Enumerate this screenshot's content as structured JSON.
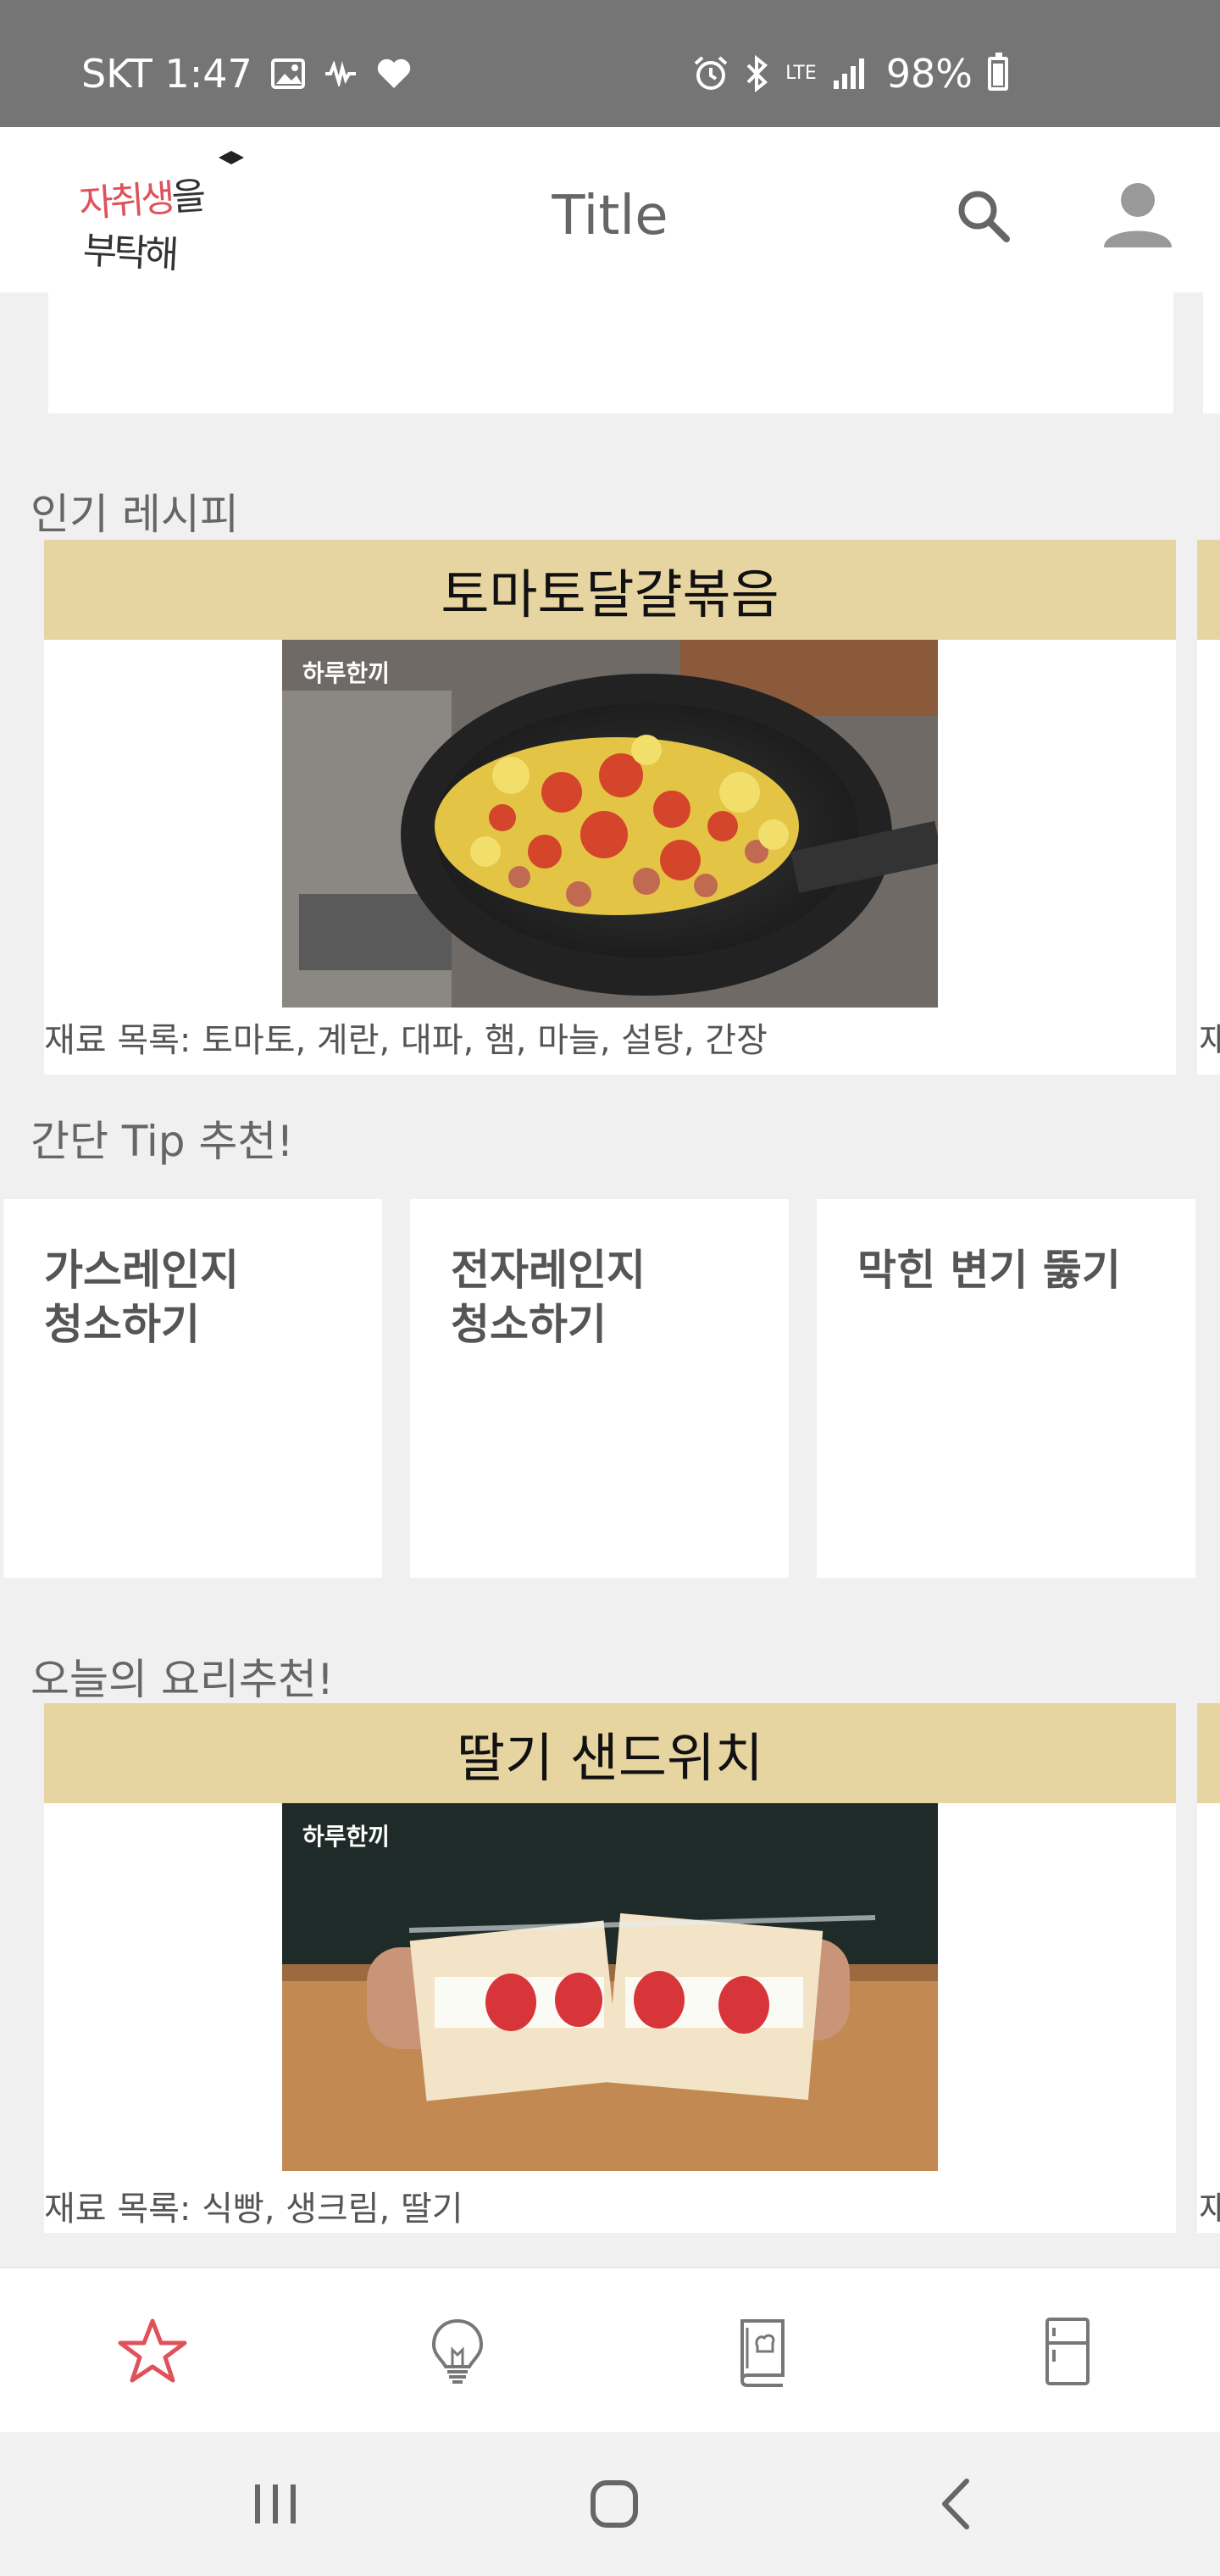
{
  "status_bar": {
    "carrier_time": "SKT 1:47",
    "network": "LTE",
    "battery": "98%"
  },
  "app_bar": {
    "title": "Title",
    "logo_line1_red": "자취생",
    "logo_line1_dark": "을",
    "logo_line2": "부탁해"
  },
  "popular": {
    "section_title": "인기 레시피",
    "card": {
      "title": "토마토달걀볶음",
      "image_label": "하루한끼",
      "ingredients": "재료 목록: 토마토, 계란, 대파, 햄, 마늘, 설탕, 간장"
    },
    "peek_text": "재"
  },
  "tips": {
    "section_title": "간단 Tip 추천!",
    "items": [
      {
        "label": "가스레인지\n청소하기"
      },
      {
        "label": "전자레인지\n청소하기"
      },
      {
        "label": "막힌 변기 뚫기"
      }
    ]
  },
  "today": {
    "section_title": "오늘의 요리추천!",
    "card": {
      "title": "딸기 샌드위치",
      "image_label": "하루한끼",
      "ingredients": "재료 목록: 식빵, 생크림, 딸기"
    },
    "peek_text": "재"
  },
  "bottom_nav": {
    "icons": [
      "star-icon",
      "lightbulb-icon",
      "recipe-book-icon",
      "fridge-icon"
    ],
    "active_color": "#e0525a",
    "inactive_color": "#777777"
  },
  "colors": {
    "status_bar": "#757575",
    "card_header": "#e6d4a1",
    "background": "#f0f0f0"
  }
}
